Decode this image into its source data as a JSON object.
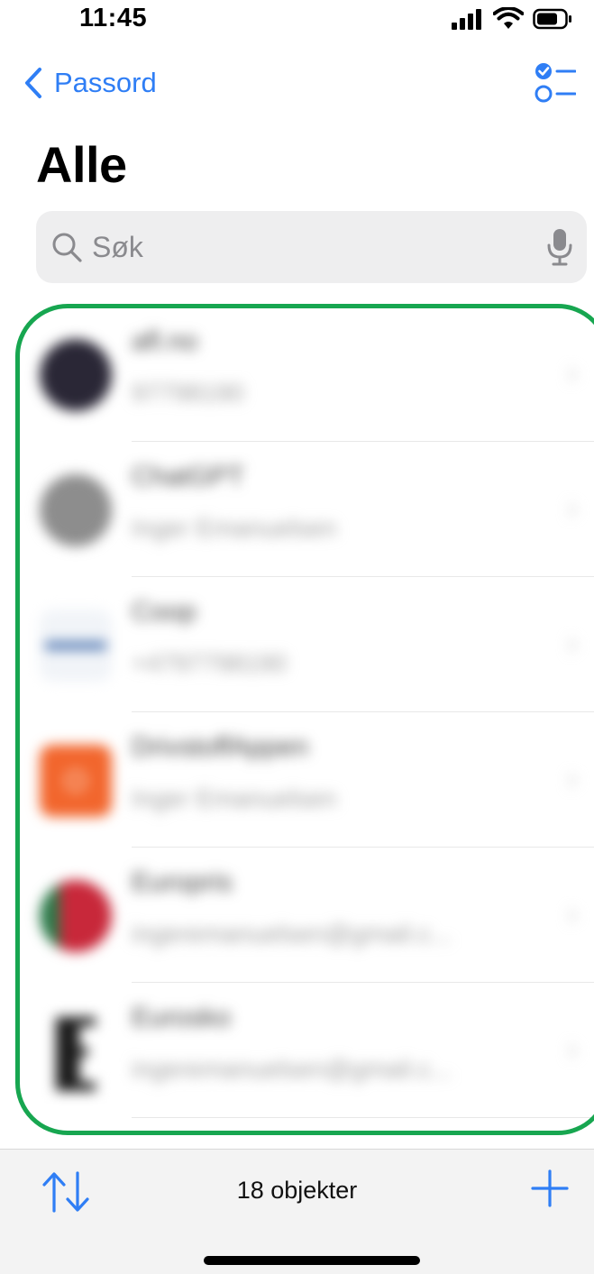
{
  "status": {
    "time": "11:45"
  },
  "nav": {
    "back_label": "Passord"
  },
  "page": {
    "title": "Alle"
  },
  "search": {
    "placeholder": "Søk"
  },
  "accounts": [
    {
      "title": "afl.no",
      "subtitle": "97798190",
      "avatar_color": "#2a2736"
    },
    {
      "title": "ChatGPT",
      "subtitle": "Inger Emanuelsen",
      "avatar_color": "#8d8d8d"
    },
    {
      "title": "Coop",
      "subtitle": "+4797798190",
      "avatar_color": "#e9eef5"
    },
    {
      "title": "DrivstoffAppen",
      "subtitle": "Inger Emanuelsen",
      "avatar_color": "#f2662d"
    },
    {
      "title": "Europris",
      "subtitle": "ingeremanuelsen@gmail.c...",
      "avatar_color": "#c8283a"
    },
    {
      "title": "Eurosko",
      "subtitle": "ingeremanuelsen@gmail.c...",
      "avatar_color": "#ffffff"
    }
  ],
  "toolbar": {
    "count_label": "18 objekter"
  },
  "colors": {
    "accent": "#2f7ef5",
    "highlight": "#17a650"
  }
}
